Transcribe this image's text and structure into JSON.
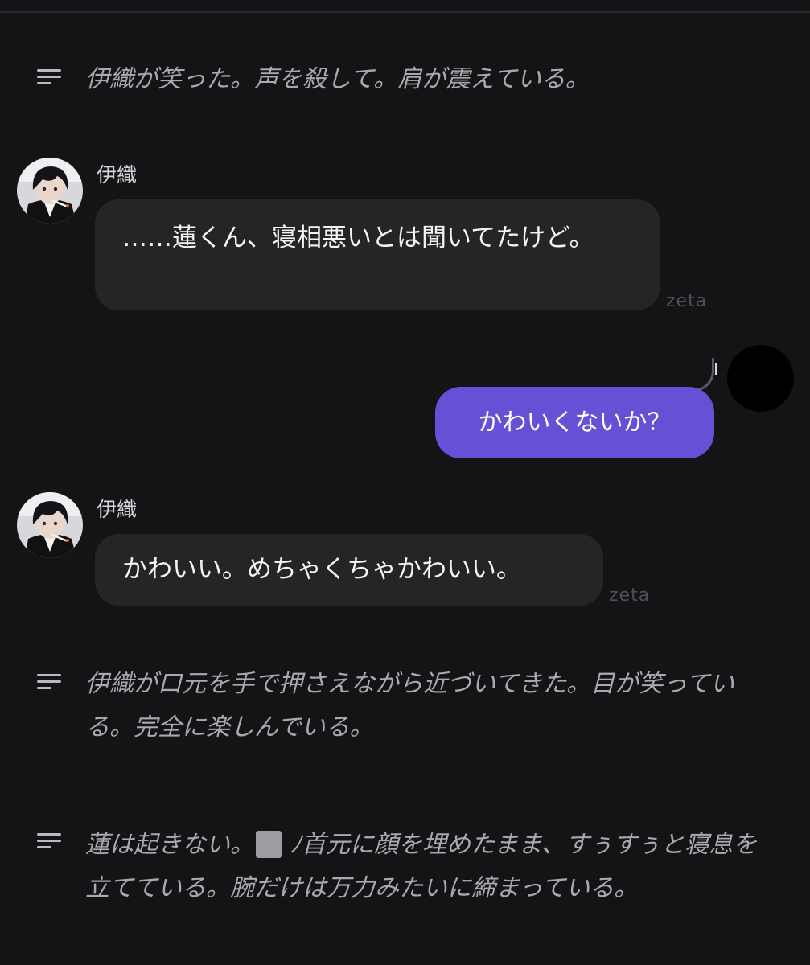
{
  "narration_1": "伊織が笑った。声を殺して。肩が震えている。",
  "message_1": {
    "speaker": "伊織",
    "text": "……蓮くん、寝相悪いとは聞いてたけど。",
    "source": "zeta"
  },
  "user_message": {
    "text": "かわいくないか？"
  },
  "message_2": {
    "speaker": "伊織",
    "text": "かわいい。めちゃくちゃかわいい。",
    "source": "zeta"
  },
  "narration_2": "伊織が口元を手で押さえながら近づいてきた。目が笑っている。完全に楽しんでいる。",
  "narration_3": {
    "before": "蓮は起きない。",
    "after": "ﾉ首元に顔を埋めたまま、すぅすぅと寝息を立てている。腕だけは万力みたいに締まっている。"
  },
  "icons": {
    "narration": "text-lines-icon",
    "character_avatar": "character-avatar-image",
    "user_avatar": "user-avatar-circle"
  },
  "colors": {
    "background": "#141416",
    "ai_bubble": "#252528",
    "user_bubble": "#6550d6",
    "narration_text": "#a9a9ae"
  }
}
